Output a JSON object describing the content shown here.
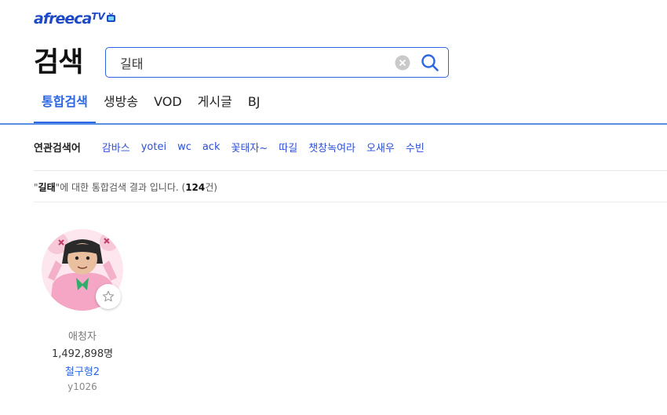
{
  "logo": {
    "text": "afreeca",
    "suffix": "TV"
  },
  "page_title": "검색",
  "search": {
    "value": "길태",
    "placeholder": ""
  },
  "tabs": [
    {
      "label": "통합검색",
      "active": true
    },
    {
      "label": "생방송",
      "active": false
    },
    {
      "label": "VOD",
      "active": false
    },
    {
      "label": "게시글",
      "active": false
    },
    {
      "label": "BJ",
      "active": false
    }
  ],
  "related": {
    "label": "연관검색어",
    "items": [
      "감바스",
      "yotei",
      "wc",
      "ack",
      "꽃태자~",
      "따길",
      "챗창녹여라",
      "오새우",
      "수빈"
    ]
  },
  "summary": {
    "quote_open": "\"",
    "keyword": "길태",
    "text": "\"에 대한 통합검색 결과 입니다. (",
    "count": "124",
    "suffix": "건)"
  },
  "streamer": {
    "fans_label": "애청자",
    "fans_count": "1,492,898명",
    "name": "철구형2",
    "id": "y1026"
  },
  "colors": {
    "accent": "#2c66e0",
    "link": "#2c4fd6"
  }
}
